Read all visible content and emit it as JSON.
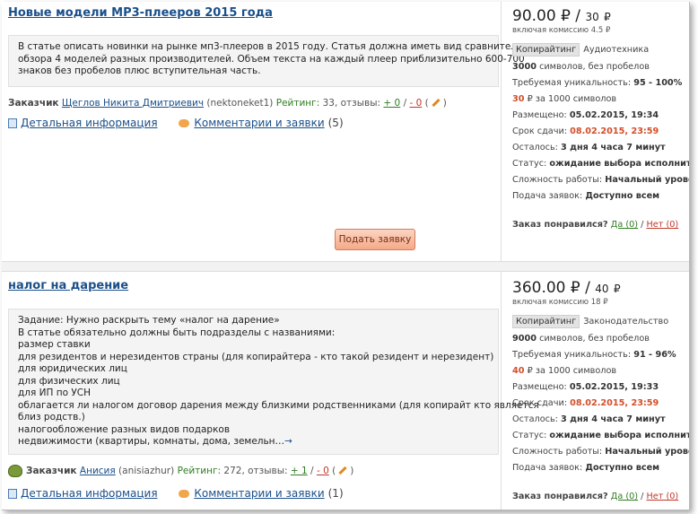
{
  "orders": [
    {
      "title": "Новые модели МР3-плееров 2015 года",
      "description": [
        "В статье описать новинки на рынке мп3-плееров в 2015 году. Статья должна иметь вид сравнительного",
        "обзора 4 моделей разных производителей. Объем текста на каждый плеер приблизительно 600-700",
        "знаков без пробелов плюс вступительная часть."
      ],
      "customer": {
        "label": "Заказчик",
        "name": "Щеглов Никита Дмитриевич",
        "login": "(nektoneket1)",
        "rating_label": "Рейтинг:",
        "rating": "33",
        "reviews_label": ", отзывы:",
        "plus": "+ 0",
        "minus": "- 0"
      },
      "details_label": "Детальная информация",
      "comments_label": "Комментарии и заявки",
      "comments_count": "(5)",
      "apply_label": "Подать заявку",
      "price": "90.00",
      "currency": "₽",
      "price_per": "30",
      "commission": "включая комиссию 4.5 ₽",
      "tag": "Копирайтинг",
      "category": "Аудиотехника",
      "chars_value": "3000",
      "chars_text": "символов, без пробелов",
      "uniq_label": "Требуемая уникальность:",
      "uniq_value": "95 - 100%",
      "rate_value": "30",
      "rate_text": "₽ за 1000 символов",
      "posted_label": "Размещено:",
      "posted_value": "05.02.2015, 19:34",
      "deadline_label": "Срок сдачи:",
      "deadline_value": "08.02.2015, 23:59",
      "left_label": "Осталось:",
      "left_value": "3 дня 4 часа 7 минут",
      "status_label": "Статус:",
      "status_value": "ожидание выбора исполнителя",
      "complexity_label": "Сложность работы:",
      "complexity_value": "Начальный уровень",
      "submission_label": "Подача заявок:",
      "submission_value": "Доступно всем",
      "liked_label": "Заказ понравился?",
      "yes_label": "Да (0)",
      "no_label": "Нет (0)"
    },
    {
      "title": "налог на дарение",
      "description": [
        "Задание: Нужно раскрыть тему «налог на дарение»",
        "В статье обязательно должны быть подразделы с названиями:",
        "размер ставки",
        "для резидентов и нерезидентов страны (для копирайтера - кто такой резидент и нерезидент)",
        "для юридических лиц",
        "для физических лиц",
        "для ИП по УСН",
        "облагается ли налогом договор дарения между близкими родственниками (для копирайт кто является",
        "близ родств.)",
        "налогообложение разных видов подарков",
        "недвижимости (квартиры, комнаты, дома, земельн…"
      ],
      "more_arrow": "→",
      "customer": {
        "label": "Заказчик",
        "name": "Анисия",
        "login": "(anisiazhur)",
        "rating_label": "Рейтинг:",
        "rating": "272",
        "reviews_label": ", отзывы:",
        "plus": "+ 1",
        "minus": "- 0"
      },
      "details_label": "Детальная информация",
      "comments_label": "Комментарии и заявки",
      "comments_count": "(1)",
      "price": "360.00",
      "currency": "₽",
      "price_per": "40",
      "commission": "включая комиссию 18 ₽",
      "tag": "Копирайтинг",
      "category": "Законодательство",
      "chars_value": "9000",
      "chars_text": "символов, без пробелов",
      "uniq_label": "Требуемая уникальность:",
      "uniq_value": "91 - 96%",
      "rate_value": "40",
      "rate_text": "₽ за 1000 символов",
      "posted_label": "Размещено:",
      "posted_value": "05.02.2015, 19:33",
      "deadline_label": "Срок сдачи:",
      "deadline_value": "08.02.2015, 23:59",
      "left_label": "Осталось:",
      "left_value": "3 дня 4 часа 7 минут",
      "status_label": "Статус:",
      "status_value": "ожидание выбора исполнителя",
      "complexity_label": "Сложность работы:",
      "complexity_value": "Начальный уровень",
      "submission_label": "Подача заявок:",
      "submission_value": "Доступно всем",
      "liked_label": "Заказ понравился?",
      "yes_label": "Да (0)",
      "no_label": "Нет (0)"
    }
  ],
  "icons": {
    "details": "document-icon",
    "comments": "speech-bubble-icon",
    "edit": "pencil-icon",
    "avatar": "user-avatar-icon"
  },
  "colors": {
    "link": "#1a4f8a",
    "accent_red": "#d24e2a",
    "positive": "#2f7d1f",
    "apply_button": "#f4a989"
  }
}
